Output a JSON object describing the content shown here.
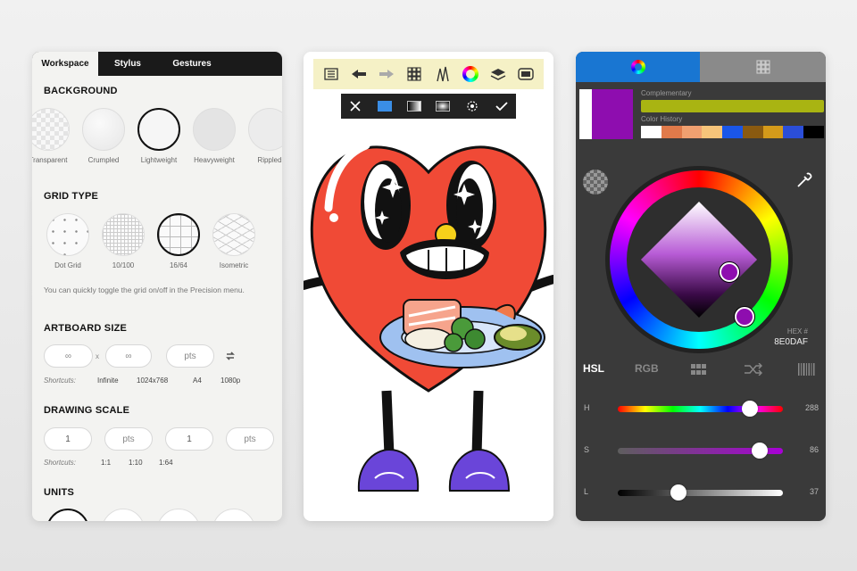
{
  "left_panel": {
    "tabs": [
      "Workspace",
      "Stylus",
      "Gestures"
    ],
    "background": {
      "title": "BACKGROUND",
      "options": [
        "Transparent",
        "Crumpled",
        "Lightweight",
        "Heavyweight",
        "Rippled"
      ]
    },
    "grid": {
      "title": "GRID TYPE",
      "options": [
        "Dot Grid",
        "10/100",
        "16/64",
        "Isometric"
      ],
      "hint": "You can quickly toggle the grid on/off in the Precision menu."
    },
    "artboard": {
      "title": "ARTBOARD SIZE",
      "width": "∞",
      "x": "x",
      "height": "∞",
      "unit": "pts",
      "shortcuts_label": "Shortcuts:",
      "shortcuts": [
        "Infinite",
        "1024x768",
        "A4",
        "1080p"
      ]
    },
    "scale": {
      "title": "DRAWING SCALE",
      "value1": "1",
      "unit1": "pts",
      "value2": "1",
      "unit2": "pts",
      "shortcuts_label": "Shortcuts:",
      "shortcuts": [
        "1:1",
        "1:10",
        "1:64"
      ]
    },
    "units": {
      "title": "UNITS"
    }
  },
  "middle_panel": {
    "toolbar_icons": [
      "layers-list-icon",
      "undo-icon",
      "redo-icon",
      "grid-icon",
      "brush-icon",
      "color-wheel-icon",
      "layers-icon",
      "artboard-icon"
    ],
    "subbar_icons": [
      "close-icon",
      "fill-blue-icon",
      "gradient-linear-icon",
      "gradient-radial-icon",
      "settings-icon",
      "check-icon"
    ],
    "accent_colors": {
      "toolbar_bg": "#f5f1c6",
      "heart": "#f04a36",
      "shoes": "#6a45d9"
    }
  },
  "right_panel": {
    "complementary_label": "Complementary",
    "history_label": "Color History",
    "history_colors": [
      "#ffffff",
      "#e07a4a",
      "#f0a070",
      "#f6c47a",
      "#1a56e8",
      "#8a5a10",
      "#d49a1a",
      "#2b4ed8",
      "#000000"
    ],
    "current_color": "#8e0daf",
    "complementary_color": "#a9b412",
    "hex_label": "HEX #",
    "hex_value": "8E0DAF",
    "modes": [
      "HSL",
      "RGB"
    ],
    "sliders": [
      {
        "label": "H",
        "value": "288",
        "fraction": 0.8
      },
      {
        "label": "S",
        "value": "86",
        "fraction": 0.86
      },
      {
        "label": "L",
        "value": "37",
        "fraction": 0.37
      }
    ]
  }
}
